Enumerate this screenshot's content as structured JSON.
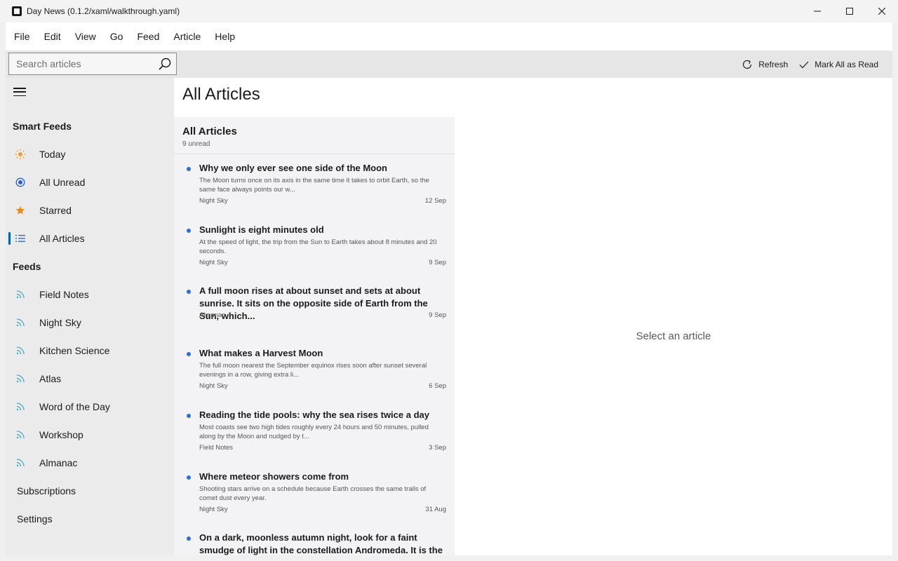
{
  "window": {
    "title": "Day News (0.1.2/xaml/walkthrough.yaml)"
  },
  "menu": [
    "File",
    "Edit",
    "View",
    "Go",
    "Feed",
    "Article",
    "Help"
  ],
  "toolbar": {
    "search_placeholder": "Search articles",
    "refresh_label": "Refresh",
    "mark_all_label": "Mark All as Read"
  },
  "sidebar": {
    "smart_feeds_header": "Smart Feeds",
    "smart_feeds": [
      {
        "label": "Today",
        "icon": "sun-icon"
      },
      {
        "label": "All Unread",
        "icon": "radio-dot-icon"
      },
      {
        "label": "Starred",
        "icon": "star-icon"
      },
      {
        "label": "All Articles",
        "icon": "list-icon",
        "selected": true
      }
    ],
    "feeds_header": "Feeds",
    "feeds": [
      {
        "label": "Field Notes",
        "icon": "rss-icon"
      },
      {
        "label": "Night Sky",
        "icon": "rss-icon"
      },
      {
        "label": "Kitchen Science",
        "icon": "rss-icon"
      },
      {
        "label": "Atlas",
        "icon": "rss-icon"
      },
      {
        "label": "Word of the Day",
        "icon": "rss-icon"
      },
      {
        "label": "Workshop",
        "icon": "rss-icon"
      },
      {
        "label": "Almanac",
        "icon": "rss-icon"
      }
    ],
    "subscriptions_label": "Subscriptions",
    "settings_label": "Settings"
  },
  "main": {
    "page_title": "All Articles",
    "list_title": "All Articles",
    "list_subtitle": "9 unread",
    "empty_detail": "Select an article",
    "articles": [
      {
        "title": "Why we only ever see one side of the Moon",
        "summary": "The Moon turns once on its axis in the same time it takes to orbit Earth, so the same face always points our w...",
        "feed": "Night Sky",
        "date": "12 Sep",
        "unread": true
      },
      {
        "title": "Sunlight is eight minutes old",
        "summary": "At the speed of light, the trip from the Sun to Earth takes about 8 minutes and 20 seconds.",
        "feed": "Night Sky",
        "date": "9 Sep",
        "unread": true
      },
      {
        "title": "A full moon rises at about sunset and sets at about sunrise. It sits on the opposite side of Earth from the Sun, which...",
        "summary": "",
        "feed": "Almanac",
        "date": "9 Sep",
        "unread": true
      },
      {
        "title": "What makes a Harvest Moon",
        "summary": "The full moon nearest the September equinox rises soon after sunset several evenings in a row, giving extra li...",
        "feed": "Night Sky",
        "date": "6 Sep",
        "unread": true
      },
      {
        "title": "Reading the tide pools: why the sea rises twice a day",
        "summary": "Most coasts see two high tides roughly every 24 hours and 50 minutes, pulled along by the Moon and nudged by t...",
        "feed": "Field Notes",
        "date": "3 Sep",
        "unread": true
      },
      {
        "title": "Where meteor showers come from",
        "summary": "Shooting stars arrive on a schedule because Earth crosses the same trails of comet dust every year.",
        "feed": "Night Sky",
        "date": "31 Aug",
        "unread": true
      },
      {
        "title": "On a dark, moonless autumn night, look for a faint smudge of light in the constellation Andromeda. It is the",
        "summary": "",
        "feed": "",
        "date": "",
        "unread": true
      }
    ]
  },
  "colors": {
    "accent": "#005fb8",
    "unread_dot": "#2a6fdb",
    "sun": "#f0a030",
    "star": "#e8891c",
    "rss": "#3aa8c8",
    "list": "#2b5fd0"
  }
}
